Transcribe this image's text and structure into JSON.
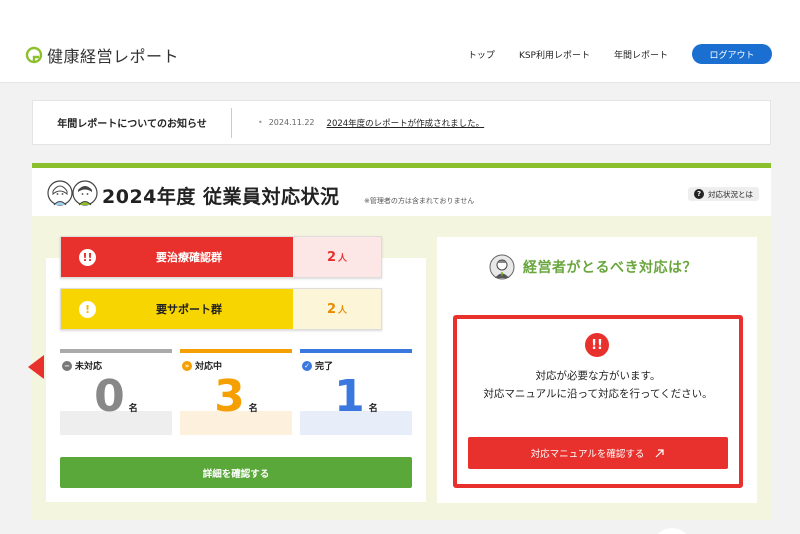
{
  "header": {
    "logo_text": "健康経営レポート",
    "nav": [
      "トップ",
      "KSP利用レポート",
      "年間レポート"
    ],
    "logout_label": "ログアウト"
  },
  "notice": {
    "title": "年間レポートについてのお知らせ",
    "date": "2024.11.22",
    "link_text": "2024年度のレポートが作成されました。"
  },
  "panel": {
    "title": "2024年度 従業員対応状況",
    "note": "※管理者の方は含まれておりません",
    "help_label": "対応状況とは"
  },
  "status_rows": [
    {
      "label": "要治療確認群",
      "count": "2",
      "unit": "人"
    },
    {
      "label": "要サポート群",
      "count": "2",
      "unit": "人"
    }
  ],
  "stats": [
    {
      "label": "未対応",
      "value": "0",
      "unit": "名",
      "color": "#888888"
    },
    {
      "label": "対応中",
      "value": "3",
      "unit": "名",
      "color": "#f5a000"
    },
    {
      "label": "完了",
      "value": "1",
      "unit": "名",
      "color": "#3a78e0"
    }
  ],
  "detail_button": "詳細を確認する",
  "right": {
    "title": "経営者がとるべき対応は？",
    "message_line1": "対応が必要な方がいます。",
    "message_line2": "対応マニュアルに沿って対応を行ってください。",
    "manual_button": "対応マニュアルを確認する"
  },
  "colors": {
    "accent_green": "#8cbf2c",
    "alert_red": "#e8312d",
    "warn_yellow": "#f6d500",
    "logout_blue": "#1a6fd1"
  }
}
